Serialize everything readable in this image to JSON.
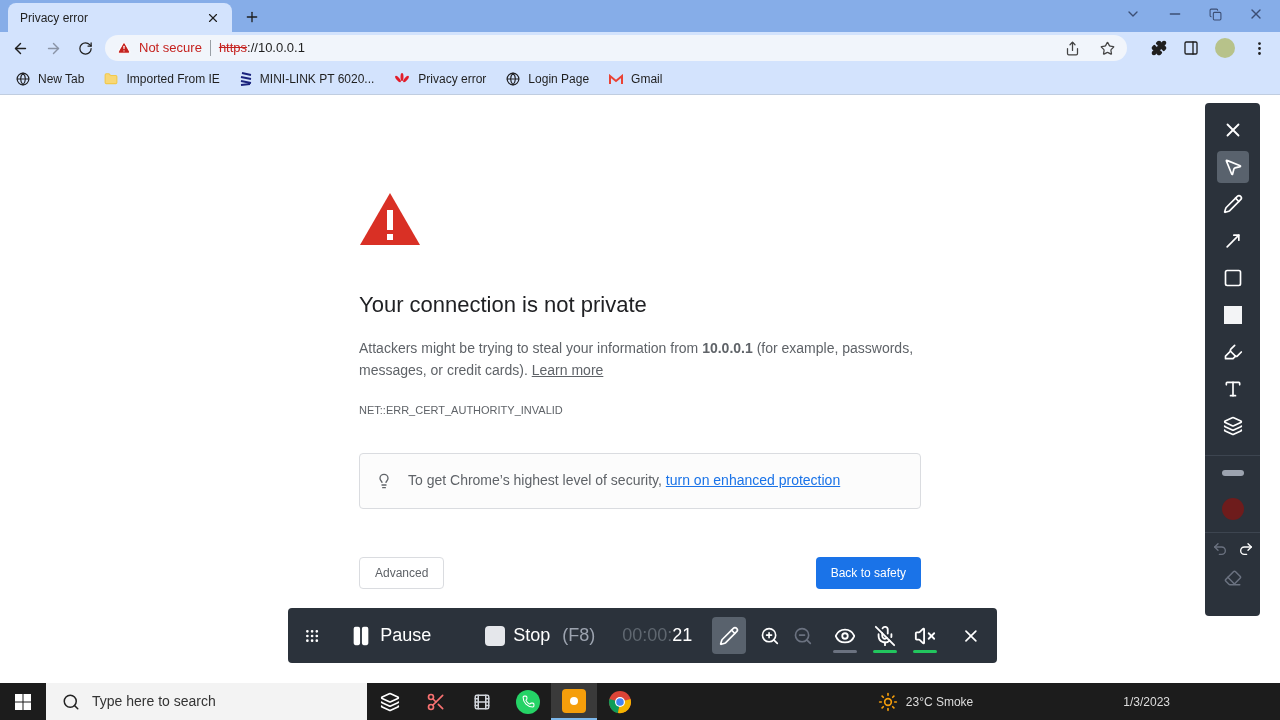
{
  "tab": {
    "title": "Privacy error",
    "selected": true
  },
  "address_bar": {
    "security_label": "Not secure",
    "scheme": "https",
    "rest": "://10.0.0.1"
  },
  "bookmarks": [
    {
      "label": "New Tab",
      "kind": "globe"
    },
    {
      "label": "Imported From IE",
      "kind": "folder"
    },
    {
      "label": "MINI-LINK PT 6020...",
      "kind": "stripes"
    },
    {
      "label": "Privacy error",
      "kind": "flower"
    },
    {
      "label": "Login Page",
      "kind": "globe"
    },
    {
      "label": "Gmail",
      "kind": "mail"
    }
  ],
  "page": {
    "title": "Your connection is not private",
    "description": "Attackers might be trying to steal your information from **10.0.0.1** (for example, passwords, messages, or credit cards).",
    "learn_more": "Learn more",
    "error_code": "NET::ERR_CERT_AUTHORITY_INVALID",
    "tip_text": "To get Chrome’s highest level of security,",
    "tip_link": "turn on enhanced protection",
    "advanced_button": "Advanced",
    "back_button": "Back to safety"
  },
  "recorder": {
    "pause_label": "Pause",
    "stop_label": "Stop",
    "stop_shortcut": "(F8)",
    "timer_prefix": "00:00:",
    "timer_seconds": "21",
    "draw_selected": true,
    "toggles": [
      {
        "kind": "webcam",
        "on": false
      },
      {
        "kind": "mic",
        "on": true
      },
      {
        "kind": "speaker",
        "on": true
      }
    ]
  },
  "annotation_tools": [
    {
      "kind": "cursor",
      "selected": true
    },
    {
      "kind": "pen",
      "selected": false
    },
    {
      "kind": "arrow",
      "selected": false
    },
    {
      "kind": "rect",
      "selected": false
    },
    {
      "kind": "filled",
      "selected": false
    },
    {
      "kind": "marker",
      "selected": false
    },
    {
      "kind": "text",
      "selected": false
    },
    {
      "kind": "counter",
      "selected": false
    }
  ],
  "style_options": [
    {
      "kind": "thickness"
    },
    {
      "kind": "swatch",
      "color": "#6e1c1c"
    }
  ],
  "taskbar": {
    "search_placeholder": "Type here to search",
    "apps": [
      {
        "kind": "taskview",
        "selected": false
      },
      {
        "kind": "snip",
        "selected": false
      },
      {
        "kind": "film",
        "selected": false
      },
      {
        "kind": "whatsapp",
        "selected": false
      },
      {
        "kind": "recorder",
        "selected": true
      },
      {
        "kind": "chrome",
        "selected": false
      }
    ],
    "weather": "23°C Smoke",
    "date": "1/3/2023"
  }
}
